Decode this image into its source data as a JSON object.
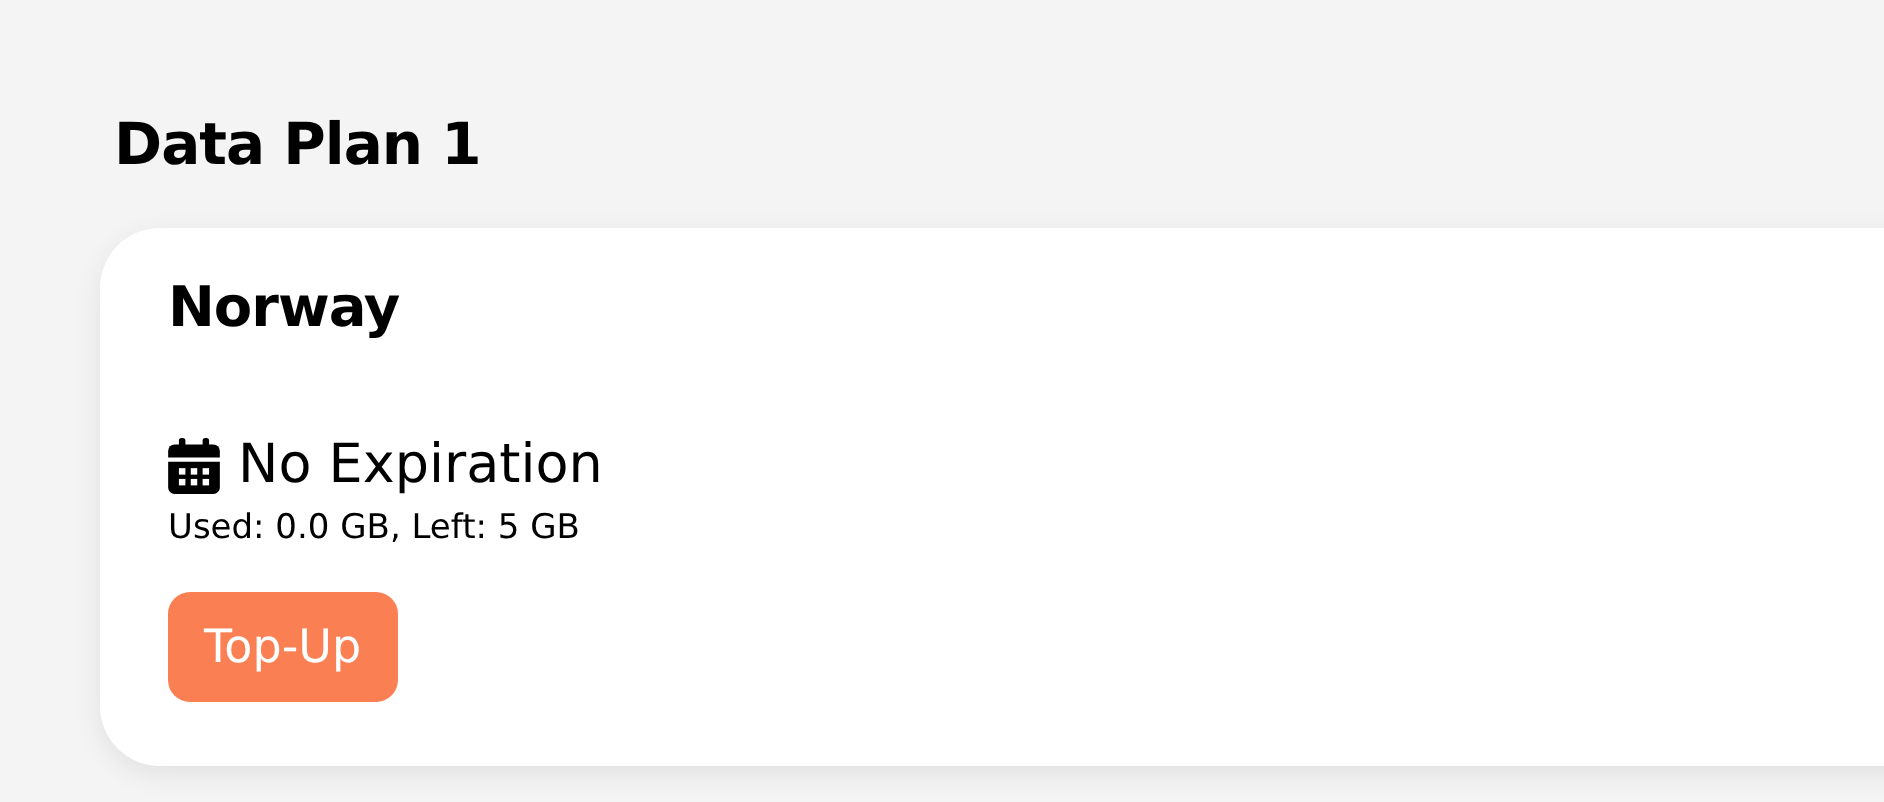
{
  "heading": "Data Plan 1",
  "plan": {
    "country": "Norway",
    "expiration": "No Expiration",
    "usage": "Used: 0.0 GB, Left: 5 GB",
    "button": "Top-Up"
  }
}
